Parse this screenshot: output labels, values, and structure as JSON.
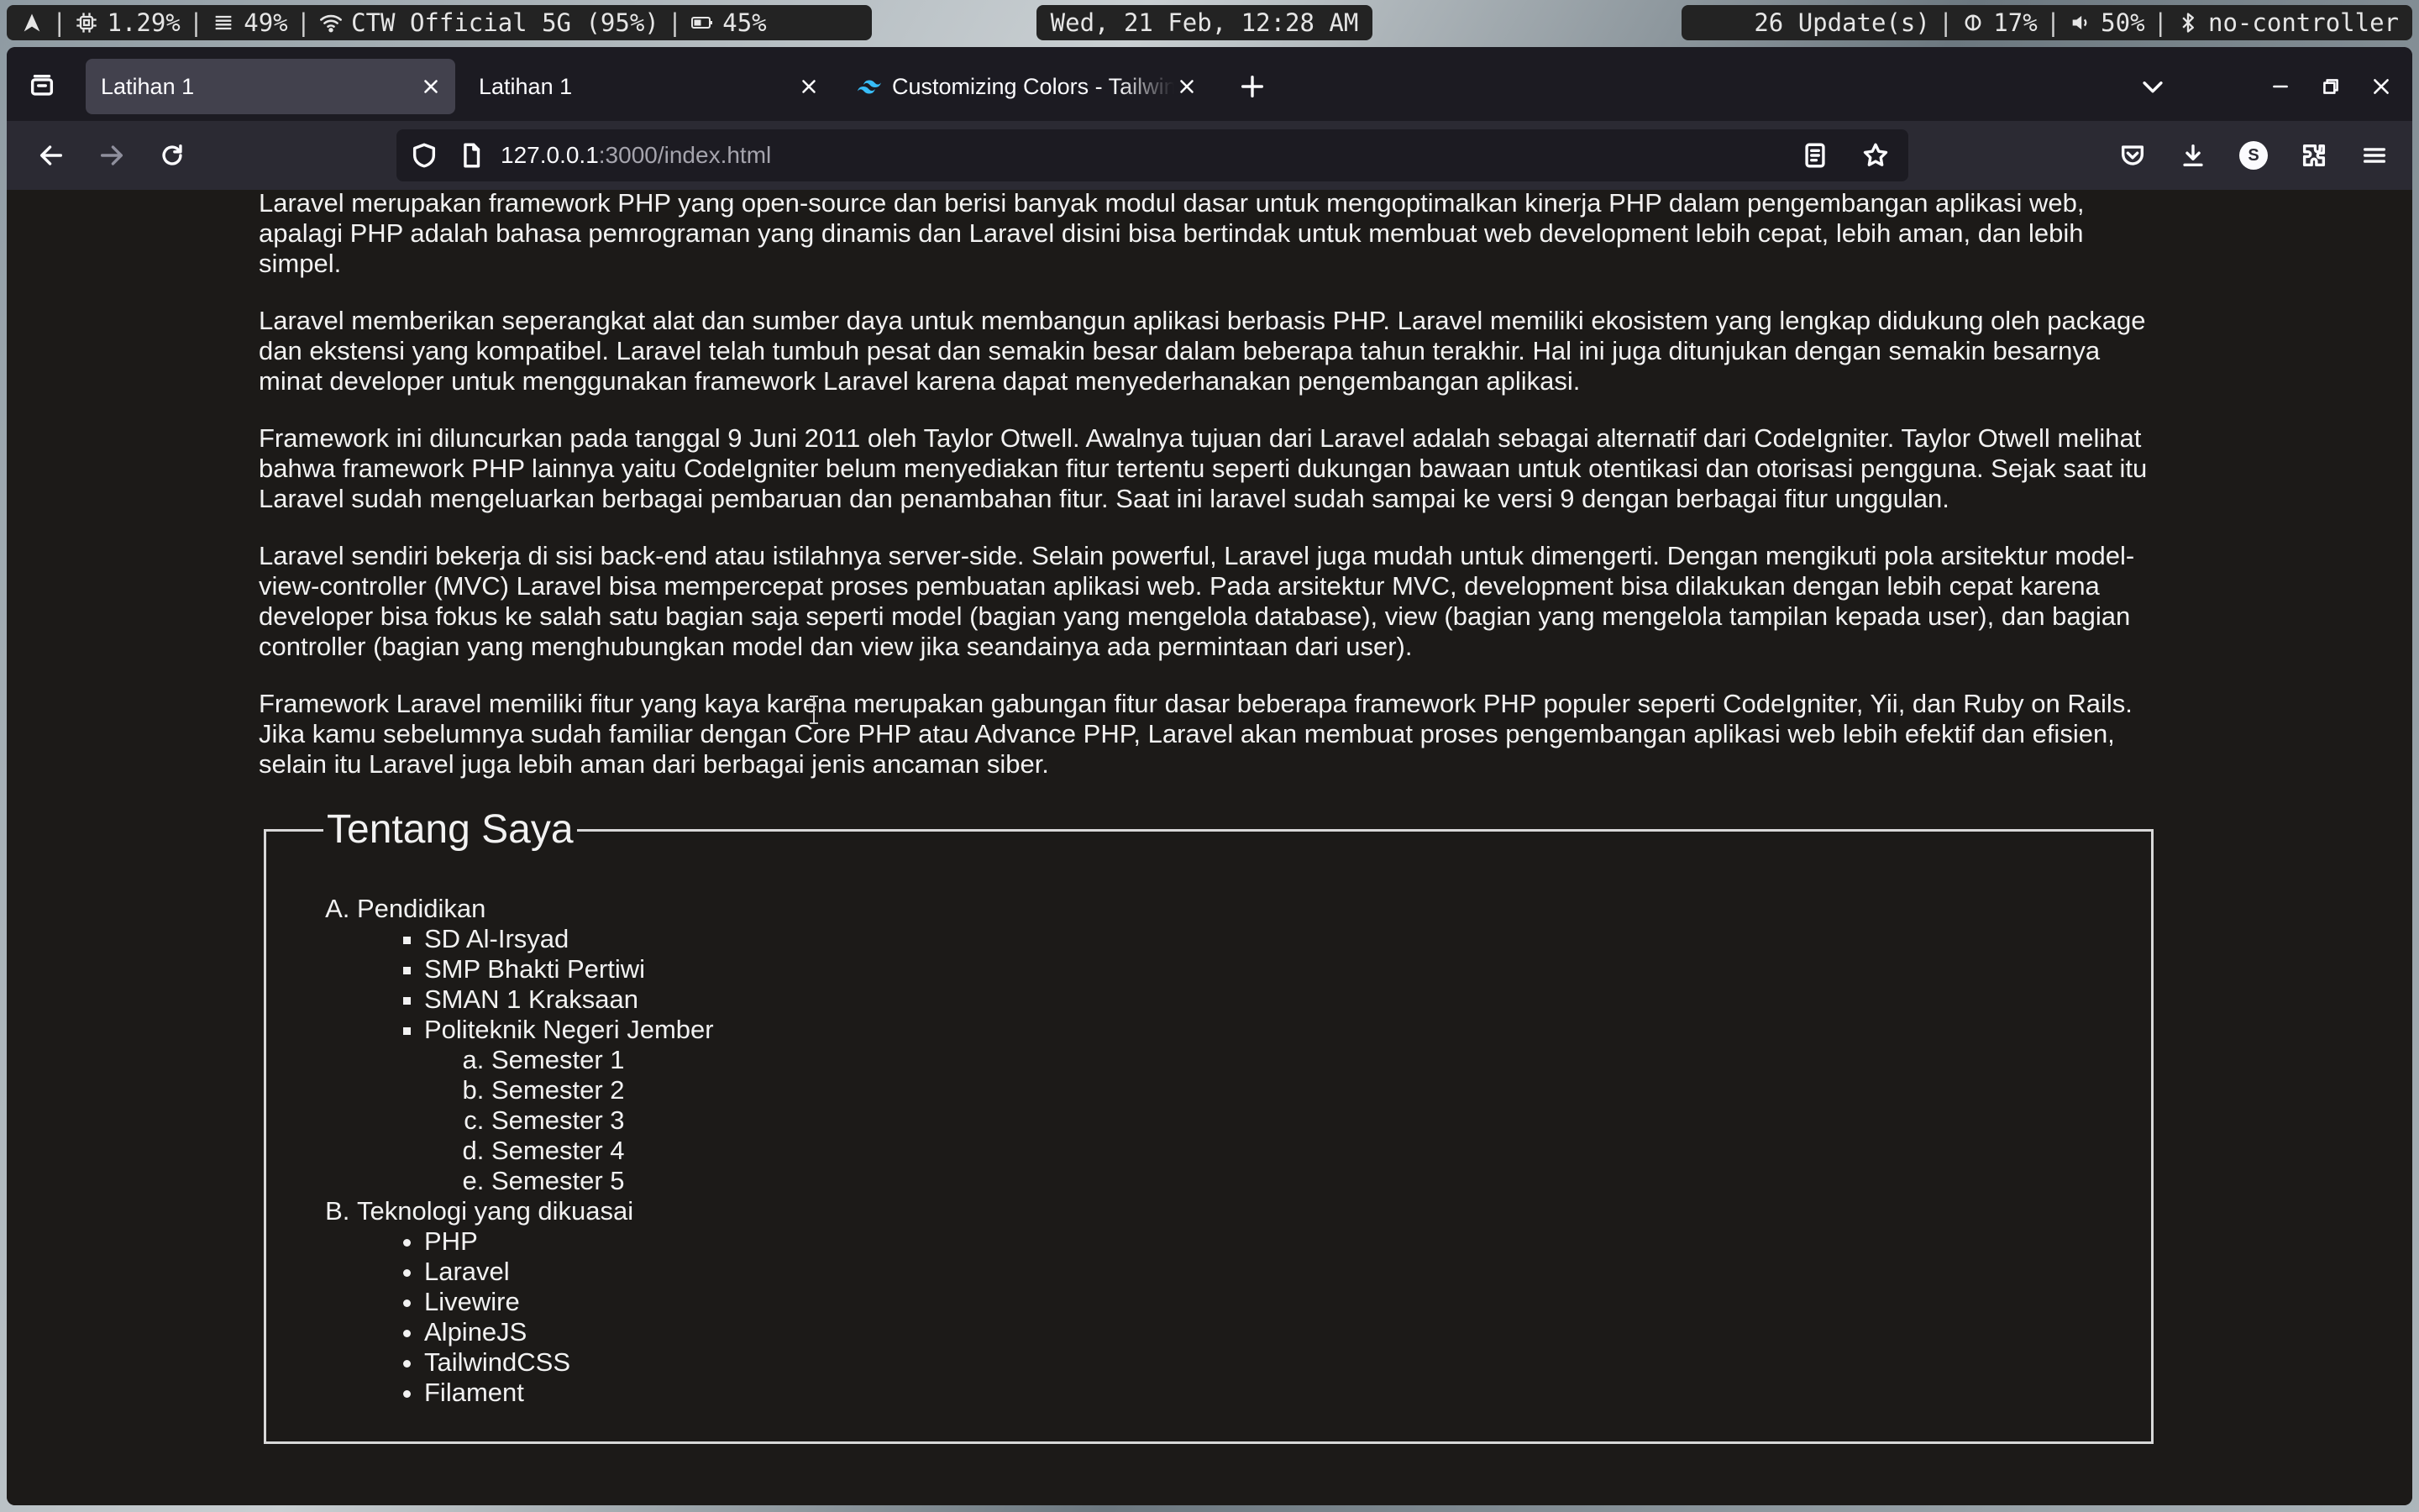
{
  "statusbar": {
    "cpu": "1.29%",
    "memory": "49%",
    "wifi": "CTW Official 5G (95%)",
    "battery": "45%",
    "datetime": "Wed, 21 Feb, 12:28 AM",
    "updates": "26 Update(s)",
    "brightness": "17%",
    "volume": "50%",
    "bluetooth": "no-controller",
    "separator": "|"
  },
  "tabs": [
    {
      "title": "Latihan 1",
      "active": true
    },
    {
      "title": "Latihan 1",
      "active": false
    },
    {
      "title": "Customizing Colors - Tailwind CSS",
      "active": false
    }
  ],
  "address": {
    "host": "127.0.0.1",
    "rest": ":3000/index.html"
  },
  "profile": {
    "initial": "S"
  },
  "article": {
    "paragraphs": [
      "Laravel merupakan framework PHP yang open-source dan berisi banyak modul dasar untuk mengoptimalkan kinerja PHP dalam pengembangan aplikasi web, apalagi PHP adalah bahasa pemrograman yang dinamis dan Laravel disini bisa bertindak untuk membuat web development lebih cepat, lebih aman, dan lebih simpel.",
      "Laravel memberikan seperangkat alat dan sumber daya untuk membangun aplikasi berbasis PHP. Laravel memiliki ekosistem yang lengkap didukung oleh package dan ekstensi yang kompatibel. Laravel telah tumbuh pesat dan semakin besar dalam beberapa tahun terakhir. Hal ini juga ditunjukan dengan semakin besarnya minat developer untuk menggunakan framework Laravel karena dapat menyederhanakan pengembangan aplikasi.",
      "Framework ini diluncurkan pada tanggal 9 Juni 2011 oleh Taylor Otwell. Awalnya tujuan dari Laravel adalah sebagai alternatif dari CodeIgniter. Taylor Otwell melihat bahwa framework PHP lainnya yaitu CodeIgniter belum menyediakan fitur tertentu seperti dukungan bawaan untuk otentikasi dan otorisasi pengguna. Sejak saat itu Laravel sudah mengeluarkan berbagai pembaruan dan penambahan fitur. Saat ini laravel sudah sampai ke versi 9 dengan berbagai fitur unggulan.",
      "Laravel sendiri bekerja di sisi back-end atau istilahnya server-side. Selain powerful, Laravel juga mudah untuk dimengerti. Dengan mengikuti pola arsitektur model-view-controller (MVC) Laravel bisa mempercepat proses pembuatan aplikasi web. Pada arsitektur MVC, development bisa dilakukan dengan lebih cepat karena developer bisa fokus ke salah satu bagian saja seperti model (bagian yang mengelola database), view (bagian yang mengelola tampilan kepada user), dan bagian controller (bagian yang menghubungkan model dan view jika seandainya ada permintaan dari user).",
      "Framework Laravel memiliki fitur yang kaya karena merupakan gabungan fitur dasar beberapa framework PHP populer seperti CodeIgniter, Yii, dan Ruby on Rails. Jika kamu sebelumnya sudah familiar dengan Core PHP atau Advance PHP, Laravel akan membuat proses pengembangan aplikasi web lebih efektif dan efisien, selain itu Laravel juga lebih aman dari berbagai jenis ancaman siber."
    ]
  },
  "about": {
    "legend": "Tentang Saya",
    "education": {
      "label": "Pendidikan",
      "schools": [
        "SD Al-Irsyad",
        "SMP Bhakti Pertiwi",
        "SMAN 1 Kraksaan",
        "Politeknik Negeri Jember"
      ],
      "semesters": [
        "Semester 1",
        "Semester 2",
        "Semester 3",
        "Semester 4",
        "Semester 5"
      ]
    },
    "tech": {
      "label": "Teknologi yang dikuasai",
      "items": [
        "PHP",
        "Laravel",
        "Livewire",
        "AlpineJS",
        "TailwindCSS",
        "Filament"
      ]
    }
  }
}
